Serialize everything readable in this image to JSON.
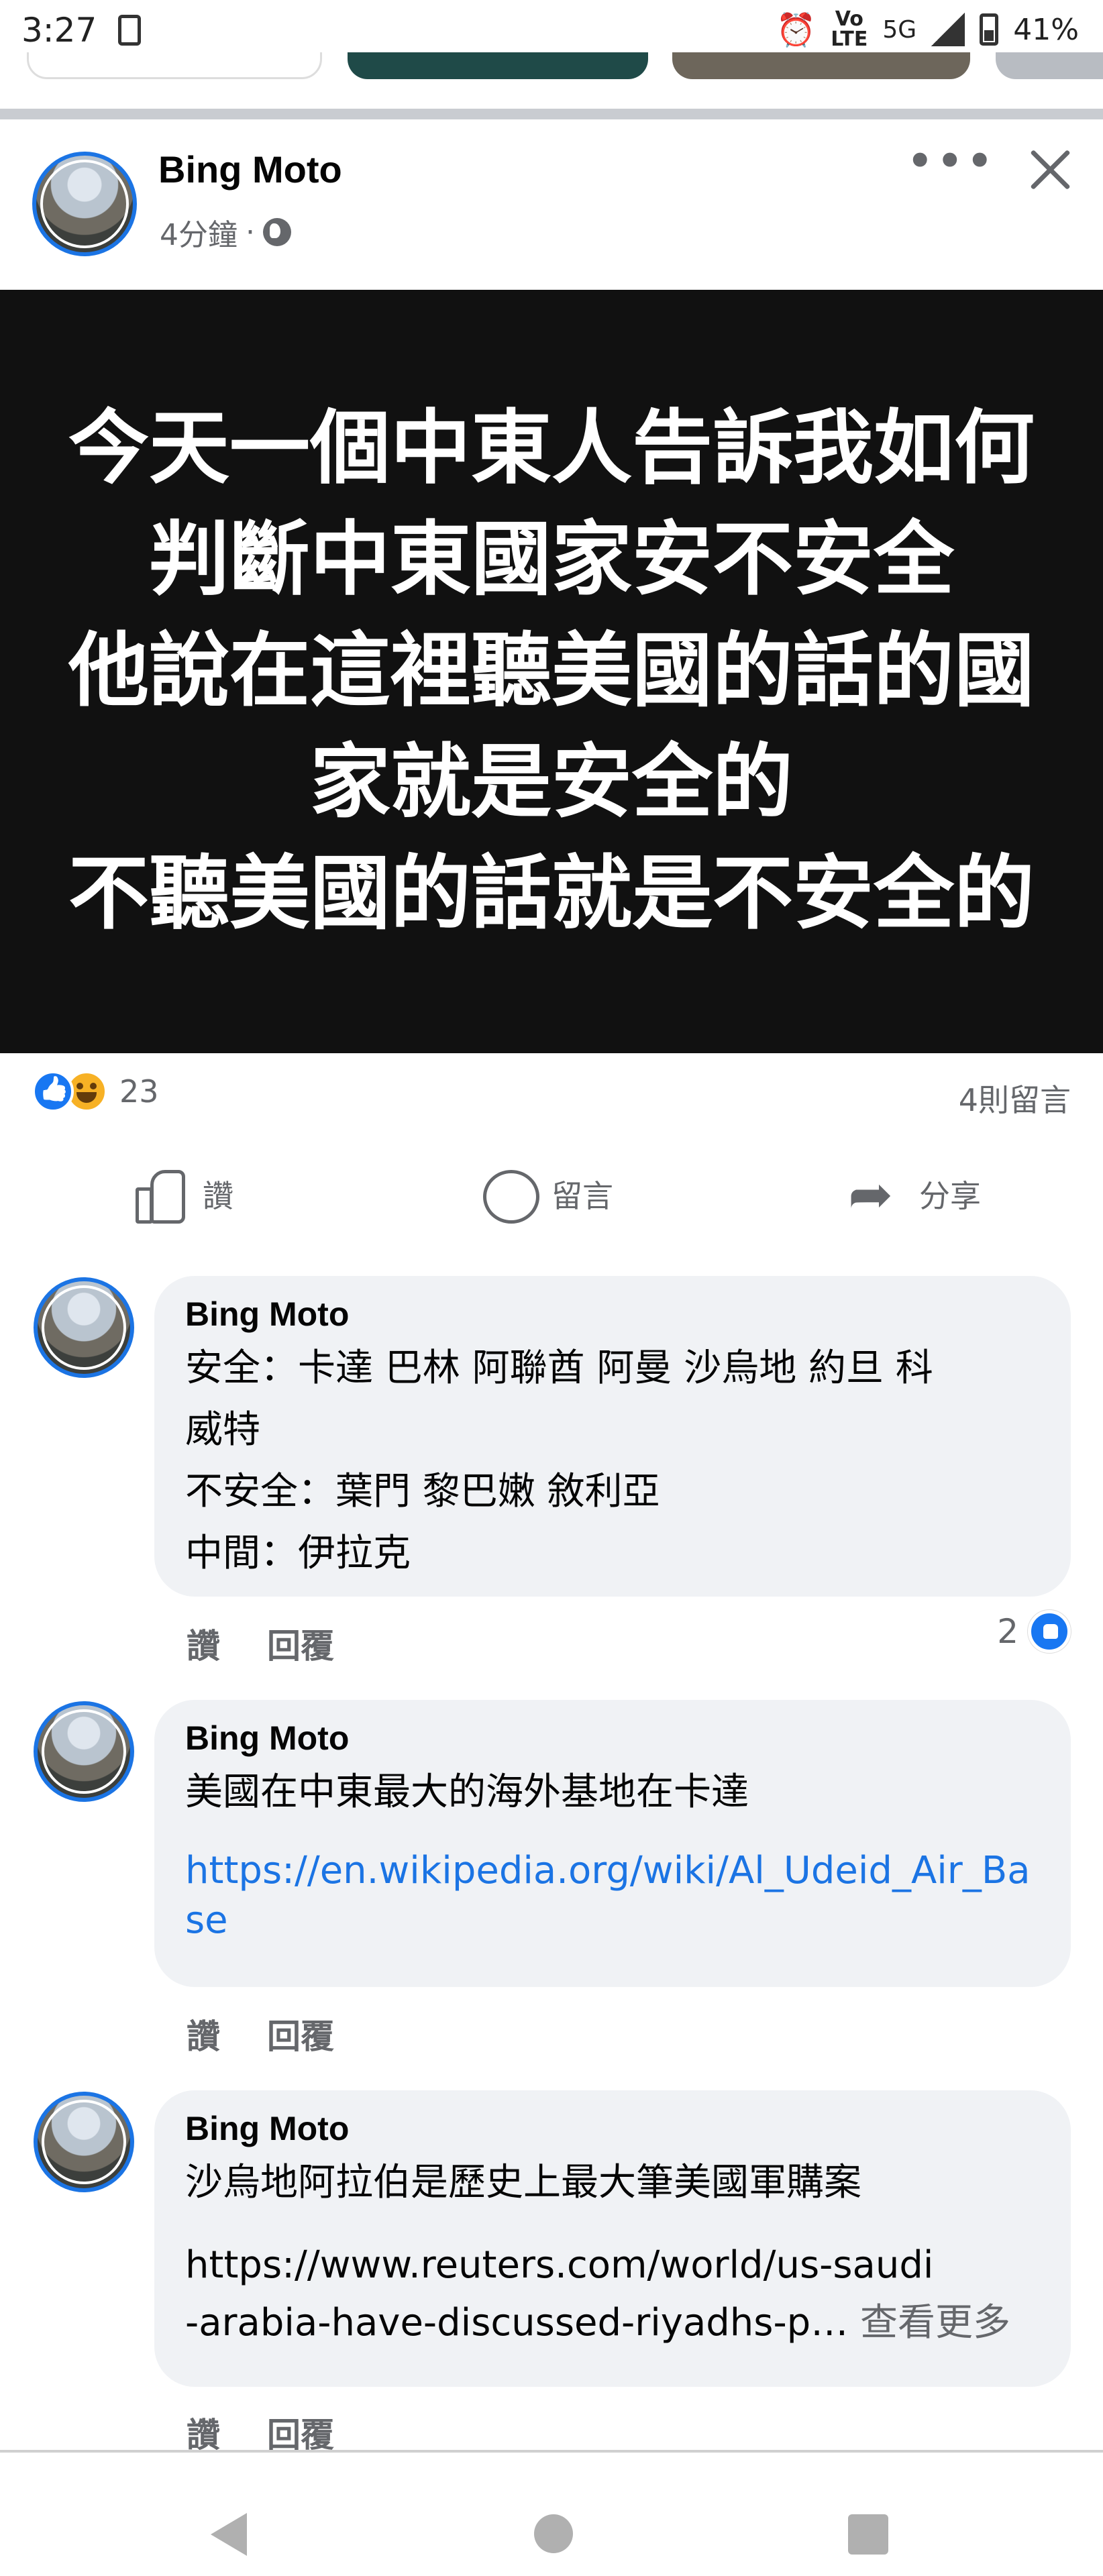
{
  "status_bar": {
    "time": "3:27",
    "battery": "41%",
    "network": "5G",
    "volte_top": "Vo",
    "volte_bottom": "LTE",
    "icons": [
      "app-notification-icon",
      "alarm-icon",
      "volte-icon",
      "signal-icon",
      "battery-icon"
    ]
  },
  "post": {
    "author": "Bing Moto",
    "time": "4分鐘",
    "separator": "·",
    "privacy_icon": "globe-icon",
    "image_text": "今天一個中東人告訴我如何\n判斷中東國家安不安全\n他說在這裡聽美國的話的國\n家就是安全的\n不聽美國的話就是不安全的",
    "reaction_count": "23",
    "reaction_icons": [
      "like-reaction-icon",
      "haha-reaction-icon"
    ],
    "comment_count": "4則留言"
  },
  "actions": {
    "like": "讚",
    "comment": "留言",
    "share": "分享"
  },
  "comments": [
    {
      "author": "Bing Moto",
      "text": "安全：卡達 巴林 阿聯酋 阿曼 沙烏地 約旦 科\n威特\n不安全：葉門 黎巴嫩 敘利亞\n中間：伊拉克",
      "like": "讚",
      "reply": "回覆",
      "reactions": "2"
    },
    {
      "author": "Bing Moto",
      "text": "美國在中東最大的海外基地在卡達",
      "link": "https://en.wikipedia.org/wiki/Al_Udeid_Air_Base",
      "like": "讚",
      "reply": "回覆"
    },
    {
      "author": "Bing Moto",
      "text": "沙烏地阿拉伯是歷史上最大筆美國軍購案",
      "link_part1": "https://www.reuters.com/world/us-saudi",
      "link_part2": "-arabia-have-discussed-riyadhs-p…",
      "see_more": "查看更多",
      "like": "讚",
      "reply": "回覆"
    }
  ],
  "colors": {
    "accent": "#1b74e4",
    "bubble": "#f0f2f5",
    "secondary_text": "#65676b",
    "image_bg": "#111111"
  }
}
